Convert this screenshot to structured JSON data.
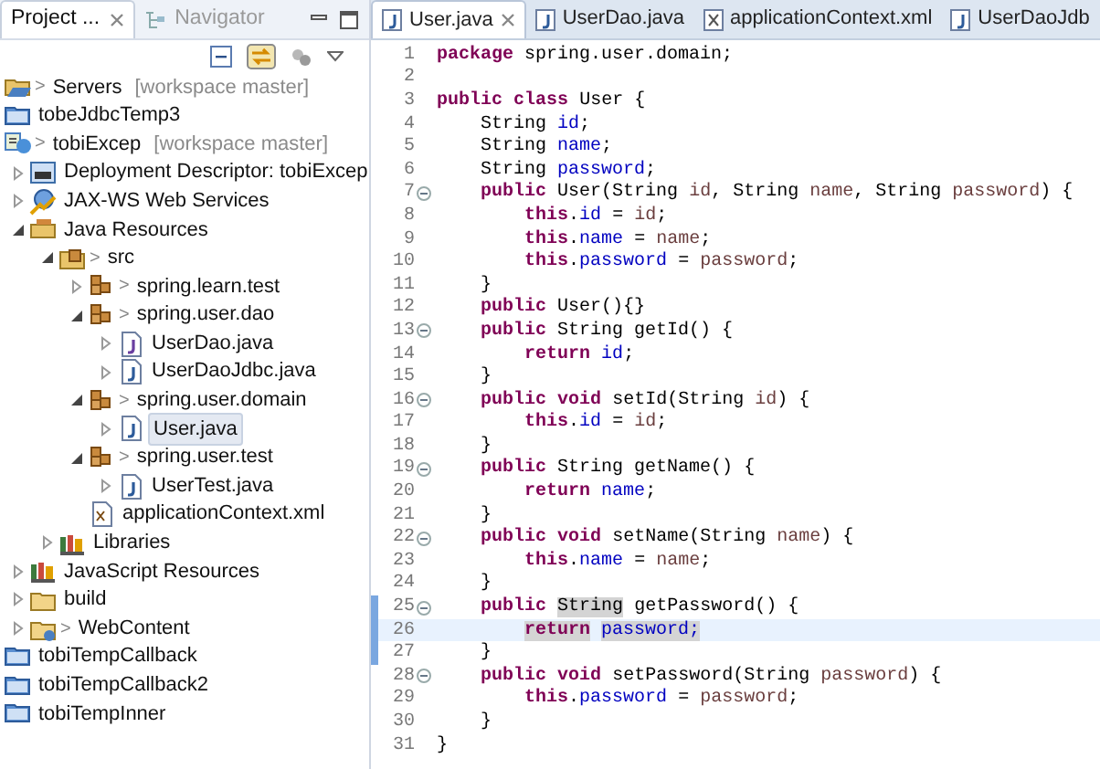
{
  "explorer": {
    "tabs": [
      {
        "label": "Project ...",
        "selected": true,
        "closable": true
      },
      {
        "label": "Navigator",
        "selected": false,
        "closable": false
      }
    ],
    "tree": [
      {
        "label": "Servers",
        "kind": "server-project",
        "git": ">",
        "decoration": "[workspace master]",
        "selected": false
      },
      {
        "label": "tobeJdbcTemp3",
        "kind": "closed-project",
        "selected": false
      },
      {
        "label": "tobiExcep",
        "kind": "web-project",
        "git": ">",
        "decoration": "[workspace master]",
        "selected": false,
        "children": [
          {
            "label": "Deployment Descriptor: tobiExcep",
            "kind": "descriptor",
            "expanded": false,
            "selected": false
          },
          {
            "label": "JAX-WS Web Services",
            "kind": "webservice",
            "expanded": false,
            "selected": false
          },
          {
            "label": "Java Resources",
            "kind": "java-resources",
            "expanded": true,
            "selected": false,
            "children": [
              {
                "label": "src",
                "kind": "source-folder",
                "git": ">",
                "expanded": true,
                "selected": false,
                "children": [
                  {
                    "label": "spring.learn.test",
                    "kind": "package",
                    "git": ">",
                    "expanded": false,
                    "selected": false
                  },
                  {
                    "label": "spring.user.dao",
                    "kind": "package",
                    "git": ">",
                    "expanded": true,
                    "selected": false,
                    "children": [
                      {
                        "label": "UserDao.java",
                        "kind": "java-interface",
                        "expanded": false,
                        "selected": false
                      },
                      {
                        "label": "UserDaoJdbc.java",
                        "kind": "java-file",
                        "expanded": false,
                        "selected": false
                      }
                    ]
                  },
                  {
                    "label": "spring.user.domain",
                    "kind": "package",
                    "git": ">",
                    "expanded": true,
                    "selected": false,
                    "children": [
                      {
                        "label": "User.java",
                        "kind": "java-file",
                        "expanded": false,
                        "selected": true
                      }
                    ]
                  },
                  {
                    "label": "spring.user.test",
                    "kind": "package",
                    "git": ">",
                    "expanded": true,
                    "selected": false,
                    "children": [
                      {
                        "label": "UserTest.java",
                        "kind": "java-file",
                        "expanded": false,
                        "selected": false
                      }
                    ]
                  },
                  {
                    "label": "applicationContext.xml",
                    "kind": "xml-file",
                    "selected": false
                  }
                ]
              },
              {
                "label": "Libraries",
                "kind": "library",
                "expanded": false,
                "selected": false
              }
            ]
          },
          {
            "label": "JavaScript Resources",
            "kind": "library",
            "expanded": false,
            "selected": false
          },
          {
            "label": "build",
            "kind": "folder",
            "expanded": false,
            "selected": false
          },
          {
            "label": "WebContent",
            "kind": "tracked-folder",
            "git": ">",
            "expanded": false,
            "selected": false
          }
        ]
      },
      {
        "label": "tobiTempCallback",
        "kind": "closed-project",
        "selected": false
      },
      {
        "label": "tobiTempCallback2",
        "kind": "closed-project",
        "selected": false
      },
      {
        "label": "tobiTempInner",
        "kind": "closed-project",
        "selected": false
      }
    ]
  },
  "editor": {
    "tabs": [
      {
        "label": "User.java",
        "kind": "java",
        "selected": true,
        "closable": true
      },
      {
        "label": "UserDao.java",
        "kind": "java",
        "selected": false,
        "closable": false
      },
      {
        "label": "applicationContext.xml",
        "kind": "xml",
        "selected": false,
        "closable": false
      },
      {
        "label": "UserDaoJdb",
        "kind": "java",
        "selected": false,
        "closable": false
      }
    ],
    "lines": [
      {
        "number": "1",
        "fold": false,
        "changed": false,
        "current": false,
        "tokens": [
          {
            "kind": "kw",
            "text": "package"
          },
          {
            "kind": "plain",
            "text": " spring.user.domain;"
          }
        ]
      },
      {
        "number": "2",
        "fold": false,
        "changed": false,
        "current": false
      },
      {
        "number": "3",
        "fold": false,
        "changed": false,
        "current": false,
        "tokens": [
          {
            "kind": "kw",
            "text": "public"
          },
          {
            "kind": "kw",
            "text": " class"
          },
          {
            "kind": "plain",
            "text": " User {"
          }
        ]
      },
      {
        "number": "4",
        "fold": false,
        "changed": false,
        "current": false,
        "tokens": [
          {
            "kind": "plain",
            "text": "    String "
          },
          {
            "kind": "field",
            "text": "id"
          },
          {
            "kind": "plain",
            "text": ";"
          }
        ]
      },
      {
        "number": "5",
        "fold": false,
        "changed": false,
        "current": false,
        "tokens": [
          {
            "kind": "plain",
            "text": "    String "
          },
          {
            "kind": "field",
            "text": "name"
          },
          {
            "kind": "plain",
            "text": ";"
          }
        ]
      },
      {
        "number": "6",
        "fold": false,
        "changed": false,
        "current": false,
        "tokens": [
          {
            "kind": "plain",
            "text": "    String "
          },
          {
            "kind": "field",
            "text": "password"
          },
          {
            "kind": "plain",
            "text": ";"
          }
        ]
      },
      {
        "number": "7",
        "fold": true,
        "changed": false,
        "current": false,
        "tokens": [
          {
            "kind": "kw",
            "text": "    public"
          },
          {
            "kind": "plain",
            "text": " User(String "
          },
          {
            "kind": "param",
            "text": "id"
          },
          {
            "kind": "plain",
            "text": ", String "
          },
          {
            "kind": "param",
            "text": "name"
          },
          {
            "kind": "plain",
            "text": ", String "
          },
          {
            "kind": "param",
            "text": "password"
          },
          {
            "kind": "plain",
            "text": ") {"
          }
        ]
      },
      {
        "number": "8",
        "fold": false,
        "changed": false,
        "current": false,
        "tokens": [
          {
            "kind": "kw",
            "text": "        this"
          },
          {
            "kind": "plain",
            "text": "."
          },
          {
            "kind": "field",
            "text": "id"
          },
          {
            "kind": "plain",
            "text": " = "
          },
          {
            "kind": "param",
            "text": "id"
          },
          {
            "kind": "plain",
            "text": ";"
          }
        ]
      },
      {
        "number": "9",
        "fold": false,
        "changed": false,
        "current": false,
        "tokens": [
          {
            "kind": "kw",
            "text": "        this"
          },
          {
            "kind": "plain",
            "text": "."
          },
          {
            "kind": "field",
            "text": "name"
          },
          {
            "kind": "plain",
            "text": " = "
          },
          {
            "kind": "param",
            "text": "name"
          },
          {
            "kind": "plain",
            "text": ";"
          }
        ]
      },
      {
        "number": "10",
        "fold": false,
        "changed": false,
        "current": false,
        "tokens": [
          {
            "kind": "kw",
            "text": "        this"
          },
          {
            "kind": "plain",
            "text": "."
          },
          {
            "kind": "field",
            "text": "password"
          },
          {
            "kind": "plain",
            "text": " = "
          },
          {
            "kind": "param",
            "text": "password"
          },
          {
            "kind": "plain",
            "text": ";"
          }
        ]
      },
      {
        "number": "11",
        "fold": false,
        "changed": false,
        "current": false,
        "tokens": [
          {
            "kind": "plain",
            "text": "    }"
          }
        ]
      },
      {
        "number": "12",
        "fold": false,
        "changed": false,
        "current": false,
        "tokens": [
          {
            "kind": "kw",
            "text": "    public"
          },
          {
            "kind": "plain",
            "text": " User(){}"
          }
        ]
      },
      {
        "number": "13",
        "fold": true,
        "changed": false,
        "current": false,
        "tokens": [
          {
            "kind": "kw",
            "text": "    public"
          },
          {
            "kind": "plain",
            "text": " String getId() {"
          }
        ]
      },
      {
        "number": "14",
        "fold": false,
        "changed": false,
        "current": false,
        "tokens": [
          {
            "kind": "kw",
            "text": "        return"
          },
          {
            "kind": "field",
            "text": " id"
          },
          {
            "kind": "plain",
            "text": ";"
          }
        ]
      },
      {
        "number": "15",
        "fold": false,
        "changed": false,
        "current": false,
        "tokens": [
          {
            "kind": "plain",
            "text": "    }"
          }
        ]
      },
      {
        "number": "16",
        "fold": true,
        "changed": false,
        "current": false,
        "tokens": [
          {
            "kind": "kw",
            "text": "    public"
          },
          {
            "kind": "kw",
            "text": " void"
          },
          {
            "kind": "plain",
            "text": " setId(String "
          },
          {
            "kind": "param",
            "text": "id"
          },
          {
            "kind": "plain",
            "text": ") {"
          }
        ]
      },
      {
        "number": "17",
        "fold": false,
        "changed": false,
        "current": false,
        "tokens": [
          {
            "kind": "kw",
            "text": "        this"
          },
          {
            "kind": "plain",
            "text": "."
          },
          {
            "kind": "field",
            "text": "id"
          },
          {
            "kind": "plain",
            "text": " = "
          },
          {
            "kind": "param",
            "text": "id"
          },
          {
            "kind": "plain",
            "text": ";"
          }
        ]
      },
      {
        "number": "18",
        "fold": false,
        "changed": false,
        "current": false,
        "tokens": [
          {
            "kind": "plain",
            "text": "    }"
          }
        ]
      },
      {
        "number": "19",
        "fold": true,
        "changed": false,
        "current": false,
        "tokens": [
          {
            "kind": "kw",
            "text": "    public"
          },
          {
            "kind": "plain",
            "text": " String getName() {"
          }
        ]
      },
      {
        "number": "20",
        "fold": false,
        "changed": false,
        "current": false,
        "tokens": [
          {
            "kind": "kw",
            "text": "        return"
          },
          {
            "kind": "field",
            "text": " name"
          },
          {
            "kind": "plain",
            "text": ";"
          }
        ]
      },
      {
        "number": "21",
        "fold": false,
        "changed": false,
        "current": false,
        "tokens": [
          {
            "kind": "plain",
            "text": "    }"
          }
        ]
      },
      {
        "number": "22",
        "fold": true,
        "changed": false,
        "current": false,
        "tokens": [
          {
            "kind": "kw",
            "text": "    public"
          },
          {
            "kind": "kw",
            "text": " void"
          },
          {
            "kind": "plain",
            "text": " setName(String "
          },
          {
            "kind": "param",
            "text": "name"
          },
          {
            "kind": "plain",
            "text": ") {"
          }
        ]
      },
      {
        "number": "23",
        "fold": false,
        "changed": false,
        "current": false,
        "tokens": [
          {
            "kind": "kw",
            "text": "        this"
          },
          {
            "kind": "plain",
            "text": "."
          },
          {
            "kind": "field",
            "text": "name"
          },
          {
            "kind": "plain",
            "text": " = "
          },
          {
            "kind": "param",
            "text": "name"
          },
          {
            "kind": "plain",
            "text": ";"
          }
        ]
      },
      {
        "number": "24",
        "fold": false,
        "changed": false,
        "current": false,
        "tokens": [
          {
            "kind": "plain",
            "text": "    }"
          }
        ]
      },
      {
        "number": "25",
        "fold": true,
        "changed": true,
        "current": false,
        "tokens": [
          {
            "kind": "kw",
            "text": "    public "
          },
          {
            "kind": "occurrence",
            "text": "String"
          },
          {
            "kind": "plain",
            "text": " getPassword() {"
          }
        ]
      },
      {
        "number": "26",
        "fold": false,
        "changed": true,
        "current": true,
        "tokens": [
          {
            "kind": "kw-occurrence",
            "text": "        return"
          },
          {
            "kind": "field-occurrence",
            "text": " password;"
          }
        ]
      },
      {
        "number": "27",
        "fold": false,
        "changed": true,
        "current": false,
        "tokens": [
          {
            "kind": "plain",
            "text": "    }"
          }
        ]
      },
      {
        "number": "28",
        "fold": true,
        "changed": false,
        "current": false,
        "tokens": [
          {
            "kind": "kw",
            "text": "    public"
          },
          {
            "kind": "kw",
            "text": " void"
          },
          {
            "kind": "plain",
            "text": " setPassword(String "
          },
          {
            "kind": "param",
            "text": "password"
          },
          {
            "kind": "plain",
            "text": ") {"
          }
        ]
      },
      {
        "number": "29",
        "fold": false,
        "changed": false,
        "current": false,
        "tokens": [
          {
            "kind": "kw",
            "text": "        this"
          },
          {
            "kind": "plain",
            "text": "."
          },
          {
            "kind": "field",
            "text": "password"
          },
          {
            "kind": "plain",
            "text": " = "
          },
          {
            "kind": "param",
            "text": "password"
          },
          {
            "kind": "plain",
            "text": ";"
          }
        ]
      },
      {
        "number": "30",
        "fold": false,
        "changed": false,
        "current": false,
        "tokens": [
          {
            "kind": "plain",
            "text": "    }"
          }
        ]
      },
      {
        "number": "31",
        "fold": false,
        "changed": false,
        "current": false,
        "tokens": [
          {
            "kind": "plain",
            "text": "}"
          }
        ]
      }
    ]
  }
}
